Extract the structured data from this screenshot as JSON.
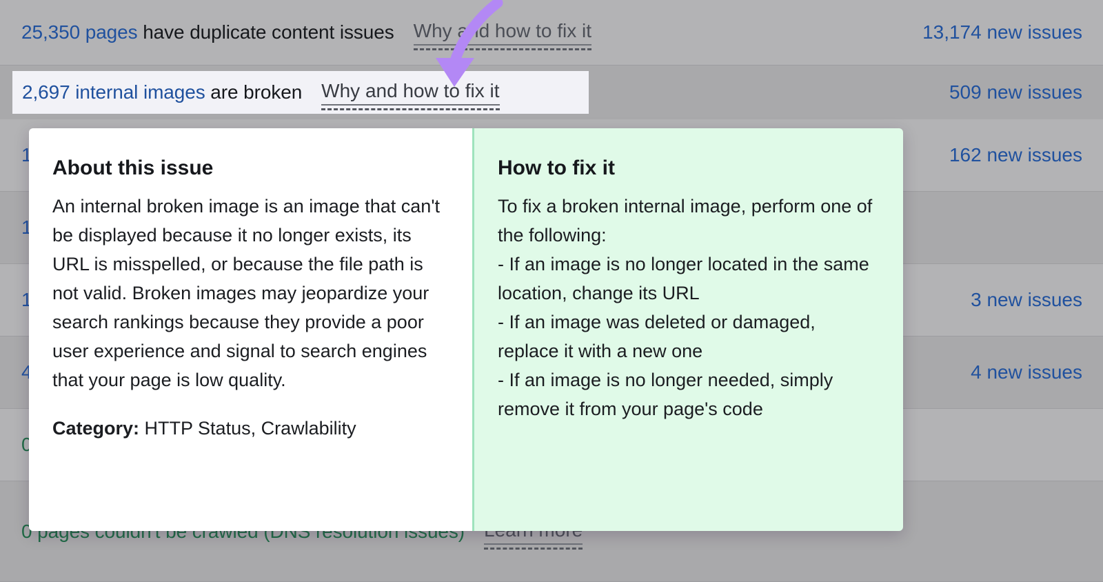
{
  "colors": {
    "link_blue": "#20519e",
    "green_text": "#1f6b45",
    "arrow_purple": "#b388f5",
    "fix_panel_green": "#e0fae8",
    "highlight_row": "#f2f2f7"
  },
  "issue_rows": [
    {
      "count": "25,350 pages",
      "description": " have duplicate content issues",
      "link": "Why and how to fix it",
      "new_issues": "13,174 new issues",
      "tone": "light",
      "style": "normal",
      "highlighted": false
    },
    {
      "count": "2,697 internal images",
      "description": " are broken",
      "link": "Why and how to fix it",
      "new_issues": "509 new issues",
      "tone": "dark",
      "style": "normal",
      "highlighted": true
    },
    {
      "count": "1",
      "description": "",
      "link": "",
      "new_issues": "162 new issues",
      "tone": "light",
      "style": "normal",
      "highlighted": false
    },
    {
      "count": "1",
      "description": "",
      "link": "",
      "new_issues": "",
      "tone": "dark",
      "style": "normal",
      "highlighted": false
    },
    {
      "count": "1",
      "description": "",
      "link": "",
      "new_issues": "3 new issues",
      "tone": "light",
      "style": "normal",
      "highlighted": false
    },
    {
      "count": "4",
      "description": "",
      "link": "",
      "new_issues": "4 new issues",
      "tone": "dark",
      "style": "normal",
      "highlighted": false
    },
    {
      "count": "0",
      "description": "",
      "link": "",
      "new_issues": "",
      "tone": "light",
      "style": "green",
      "highlighted": false
    },
    {
      "count": "0 pages",
      "description": " couldn't be crawled (DNS resolution issues)",
      "link": "Learn more",
      "new_issues": "",
      "tone": "dark",
      "style": "green",
      "highlighted": false
    }
  ],
  "popup": {
    "about": {
      "title": "About this issue",
      "body": "An internal broken image is an image that can't be displayed because it no longer exists, its URL is misspelled, or because the file path is not valid. Broken images may jeopardize your search rankings because they provide a poor user experience and signal to search engines that your page is low quality.",
      "category_label": "Category:",
      "category_value": " HTTP Status, Crawlability"
    },
    "fix": {
      "title": "How to fix it",
      "body": "To fix a broken internal image, perform one of the following:\n- If an image is no longer located in the same location, change its URL\n- If an image was deleted or damaged, replace it with a new one\n- If an image is no longer needed, simply remove it from your page's code"
    }
  },
  "annotation": {
    "arrow": "curved-down-arrow"
  }
}
